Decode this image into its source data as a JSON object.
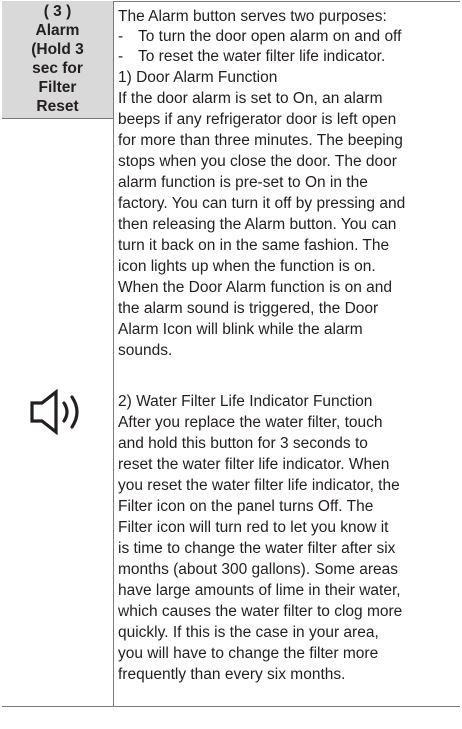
{
  "header": {
    "lines": [
      "( 3 )",
      "Alarm",
      "(Hold 3",
      "sec for",
      "Filter",
      "Reset"
    ]
  },
  "icon": {
    "name": "speaker-alarm-icon"
  },
  "intro": "The Alarm button serves two purposes:",
  "purposes": [
    {
      "dash": "-",
      "text": "To turn the door open alarm on and off"
    },
    {
      "dash": "-",
      "text": "To reset the water filter life indicator."
    }
  ],
  "section1": {
    "title": "1) Door Alarm Function",
    "lines": [
      "If the door alarm is set to On, an alarm",
      "beeps if any refrigerator door is left open",
      "for more than three minutes. The beeping",
      "stops when you close the door. The door",
      "alarm function is pre-set to On in the",
      "factory. You can turn it off by pressing and",
      "then releasing the Alarm button. You can",
      "turn it back on in the same fashion. The",
      "icon lights up when the function is on.",
      "When the Door Alarm function is on and",
      "the alarm sound is triggered, the Door",
      "Alarm Icon will blink while the alarm",
      "sounds."
    ]
  },
  "section2": {
    "title": "2) Water Filter Life Indicator Function",
    "lines": [
      "After you replace the water filter, touch",
      "and hold this button for 3 seconds to",
      "reset the water filter life indicator. When",
      "you reset the water filter life indicator, the",
      "Filter icon on the panel turns Off. The",
      "Filter icon will turn red to let you know it",
      "is time to change the water filter after six",
      "months (about 300 gallons). Some areas",
      "have large amounts of lime in their water,",
      "which causes the water filter to clog more",
      "quickly. If this is the case in your area,",
      "you will have to change the filter more",
      "frequently than every six months."
    ]
  }
}
